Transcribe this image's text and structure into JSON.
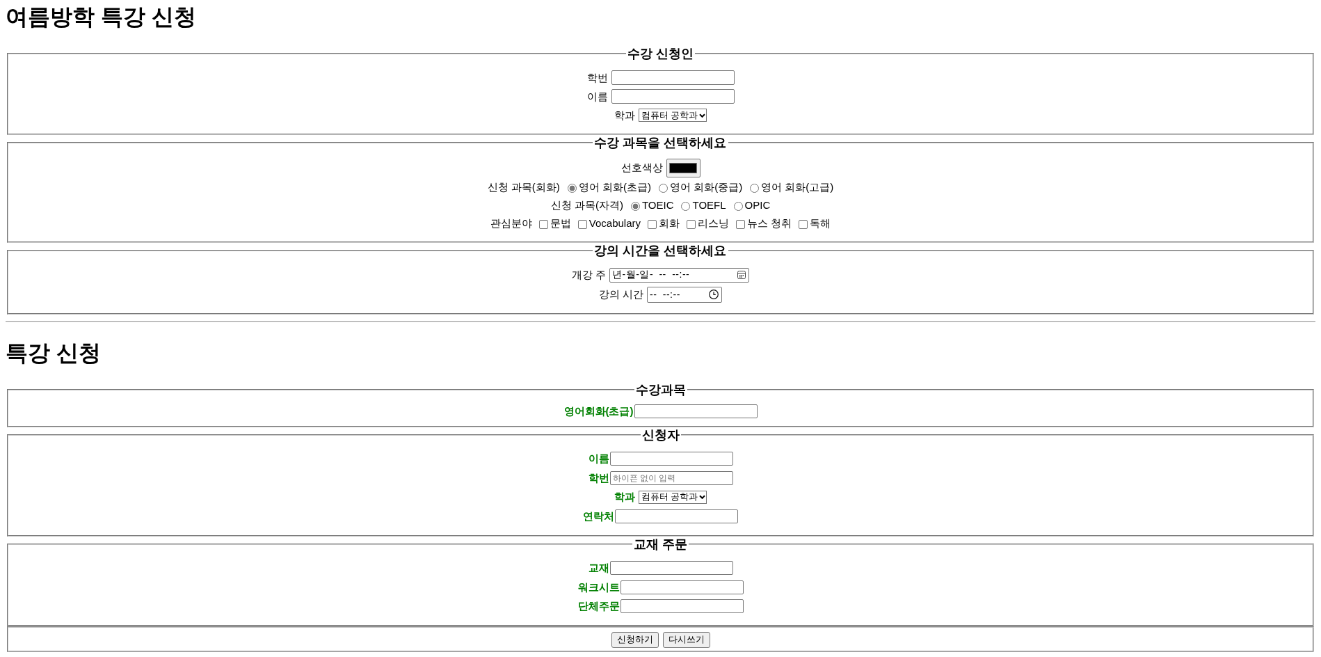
{
  "forms": [
    {
      "title": "여름방학 특강 신청",
      "kind": "plain",
      "sections": [
        {
          "legend": "수강 신청인",
          "rows": [
            {
              "kind": "text",
              "label": "학번"
            },
            {
              "kind": "text",
              "label": "이름"
            },
            {
              "kind": "select",
              "label": "학과",
              "value": "컴퓨터 공학과"
            }
          ]
        },
        {
          "legend": "수강 과목을 선택하세요",
          "rows": [
            {
              "kind": "color",
              "label": "선호색상",
              "color": "#000000"
            },
            {
              "kind": "radio",
              "label": "신청 과목(회화)",
              "options": [
                {
                  "label": "영어 회화(초급)",
                  "selected": true
                },
                {
                  "label": "영어 회화(중급)",
                  "selected": false
                },
                {
                  "label": "영어 회화(고급)",
                  "selected": false
                }
              ]
            },
            {
              "kind": "radio",
              "label": "신청 과목(자격)",
              "options": [
                {
                  "label": "TOEIC",
                  "selected": true
                },
                {
                  "label": "TOEFL",
                  "selected": false
                },
                {
                  "label": "OPIC",
                  "selected": false
                }
              ]
            },
            {
              "kind": "checkbox",
              "label": "관심분야",
              "options": [
                {
                  "label": "문법",
                  "checked": false
                },
                {
                  "label": "Vocabulary",
                  "checked": false
                },
                {
                  "label": "회화",
                  "checked": false
                },
                {
                  "label": "리스닝",
                  "checked": false
                },
                {
                  "label": "뉴스 청취",
                  "checked": false
                },
                {
                  "label": "독해",
                  "checked": false
                }
              ]
            }
          ]
        },
        {
          "legend": "강의 시간을 선택하세요",
          "rows": [
            {
              "kind": "datetime",
              "label": "개강 주",
              "value": "년-월-일- -- --:--"
            },
            {
              "kind": "time",
              "label": "강의 시간",
              "value": "-- --:--"
            }
          ]
        }
      ]
    },
    {
      "title": "특강 신청",
      "kind": "emphasized",
      "sections": [
        {
          "legend": "수강과목",
          "rows": [
            {
              "kind": "text",
              "label": "영어회화(초급)"
            }
          ]
        },
        {
          "legend": "신청자",
          "rows": [
            {
              "kind": "text",
              "label": "이름"
            },
            {
              "kind": "text",
              "label": "학번",
              "placeholder": "하이픈 없이 입력"
            },
            {
              "kind": "select",
              "label": "학과",
              "value": "컴퓨터 공학과"
            },
            {
              "kind": "text",
              "label": "연락처"
            }
          ]
        },
        {
          "legend": "교재 주문",
          "rows": [
            {
              "kind": "text",
              "label": "교재"
            },
            {
              "kind": "text",
              "label": "워크시트"
            },
            {
              "kind": "text",
              "label": "단체주문"
            }
          ]
        },
        {
          "rows": [
            {
              "kind": "buttons",
              "buttons": [
                "신청하기",
                "다시쓰기"
              ]
            }
          ]
        }
      ]
    }
  ]
}
